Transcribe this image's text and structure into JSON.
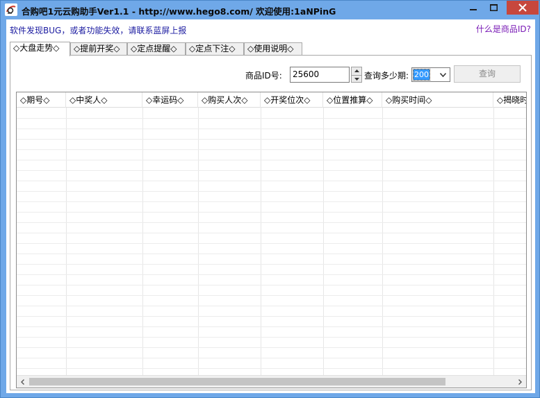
{
  "window": {
    "title": "合购吧1元云购助手Ver1.1 - http://www.hego8.com/  欢迎使用:1aNPinG"
  },
  "header": {
    "notice": "软件发现BUG，或者功能失效，请联系蓝屏上报",
    "product_id_help": "什么是商品ID?"
  },
  "tabs": [
    {
      "label": "◇大盘走势◇",
      "active": true
    },
    {
      "label": "◇提前开奖◇",
      "active": false
    },
    {
      "label": "◇定点提醒◇",
      "active": false
    },
    {
      "label": "◇定点下注◇",
      "active": false
    },
    {
      "label": "◇使用说明◇",
      "active": false
    }
  ],
  "query": {
    "product_id_label": "商品ID号:",
    "product_id_value": "25600",
    "periods_label": "查询多少期:",
    "periods_value": "200",
    "query_button": "查询"
  },
  "table": {
    "columns": [
      "◇期号◇",
      "◇中奖人◇",
      "◇幸运码◇",
      "◇购买人次◇",
      "◇开奖位次◇",
      "◇位置推算◇",
      "◇购买时间◇",
      "◇揭晓时间◇"
    ],
    "rows": []
  },
  "icons": {
    "app": "app-logo-icon",
    "minimize": "minimize-icon",
    "maximize": "maximize-icon",
    "close": "close-icon"
  },
  "colors": {
    "titlebar": "#6fa8e8",
    "close_button": "#c7473d",
    "notice_text": "#1a1aa0",
    "help_link": "#7a1bb6",
    "selection": "#3399ff"
  }
}
